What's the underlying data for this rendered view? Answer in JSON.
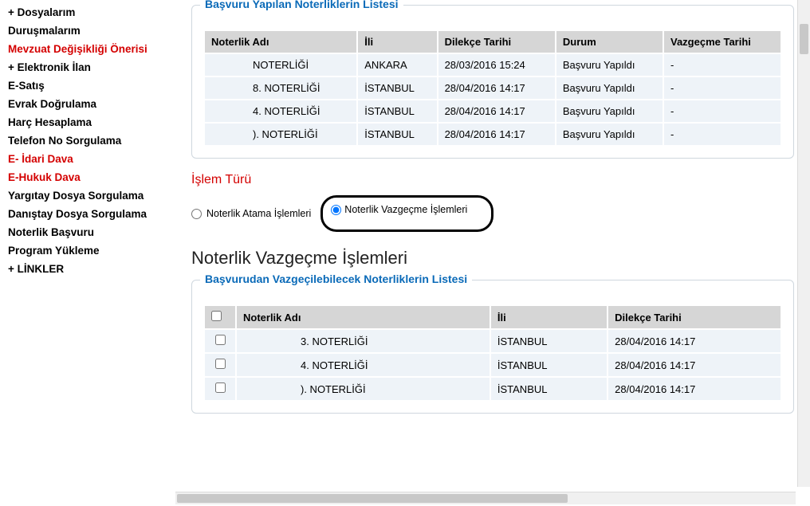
{
  "sidebar": {
    "items": [
      {
        "label": "+ Dosyalarım",
        "hl": false
      },
      {
        "label": "Duruşmalarım",
        "hl": false
      },
      {
        "label": "Mevzuat Değişikliği Önerisi",
        "hl": true
      },
      {
        "label": "+ Elektronik İlan",
        "hl": false
      },
      {
        "label": "E-Satış",
        "hl": false
      },
      {
        "label": "Evrak Doğrulama",
        "hl": false
      },
      {
        "label": "Harç Hesaplama",
        "hl": false
      },
      {
        "label": "Telefon No Sorgulama",
        "hl": false
      },
      {
        "label": "E- İdari Dava",
        "hl": true
      },
      {
        "label": "E-Hukuk Dava",
        "hl": true
      },
      {
        "label": "Yargıtay Dosya Sorgulama",
        "hl": false
      },
      {
        "label": "Danıştay Dosya Sorgulama",
        "hl": false
      },
      {
        "label": "Noterlik Başvuru",
        "hl": false
      },
      {
        "label": "Program Yükleme",
        "hl": false
      },
      {
        "label": "+ LİNKLER",
        "hl": false
      }
    ]
  },
  "panel1": {
    "legend": "Başvuru Yapılan Noterliklerin Listesi",
    "headers": {
      "c0": "Noterlik Adı",
      "c1": "İli",
      "c2": "Dilekçe Tarihi",
      "c3": "Durum",
      "c4": "Vazgeçme Tarihi"
    },
    "rows": [
      {
        "name": "NOTERLİĞİ",
        "city": "ANKARA",
        "date": "28/03/2016 15:24",
        "status": "Başvuru Yapıldı",
        "cancel": "-"
      },
      {
        "name": "8. NOTERLİĞİ",
        "city": "İSTANBUL",
        "date": "28/04/2016 14:17",
        "status": "Başvuru Yapıldı",
        "cancel": "-"
      },
      {
        "name": "4. NOTERLİĞİ",
        "city": "İSTANBUL",
        "date": "28/04/2016 14:17",
        "status": "Başvuru Yapıldı",
        "cancel": "-"
      },
      {
        "name": "). NOTERLİĞİ",
        "city": "İSTANBUL",
        "date": "28/04/2016 14:17",
        "status": "Başvuru Yapıldı",
        "cancel": "-"
      }
    ]
  },
  "operation": {
    "title": "İşlem Türü",
    "radio1": "Noterlik Atama İşlemleri",
    "radio2": "Noterlik Vazgeçme İşlemleri"
  },
  "section_header": "Noterlik Vazgeçme İşlemleri",
  "panel2": {
    "legend": "Başvurudan Vazgeçilebilecek Noterliklerin Listesi",
    "headers": {
      "c0": "Noterlik Adı",
      "c1": "İli",
      "c2": "Dilekçe Tarihi"
    },
    "rows": [
      {
        "name": "3. NOTERLİĞİ",
        "city": "İSTANBUL",
        "date": "28/04/2016 14:17"
      },
      {
        "name": "4. NOTERLİĞİ",
        "city": "İSTANBUL",
        "date": "28/04/2016 14:17"
      },
      {
        "name": "). NOTERLİĞİ",
        "city": "İSTANBUL",
        "date": "28/04/2016 14:17"
      }
    ]
  }
}
